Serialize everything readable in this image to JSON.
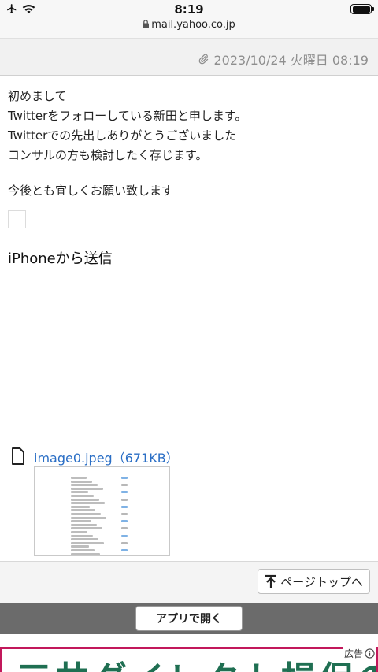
{
  "status_bar": {
    "time": "8:19",
    "url": "mail.yahoo.co.jp"
  },
  "header": {
    "date": "2023/10/24 火曜日 08:19"
  },
  "mail": {
    "lines": [
      "初めまして",
      "Twitterをフォローしている新田と申します。",
      "Twitterでの先出しありがとうございました",
      "コンサルの方も検討したく存じます。"
    ],
    "closing": "今後とも宜しくお願い致します",
    "signature": "iPhoneから送信"
  },
  "attachment": {
    "file_name": "image0.jpeg（671KB）"
  },
  "footer": {
    "page_top_label": "ページトップへ",
    "open_app_label": "アプリで開く",
    "ad_label": "広告",
    "ad_banner_text": "三井ダイレクト損保の"
  }
}
